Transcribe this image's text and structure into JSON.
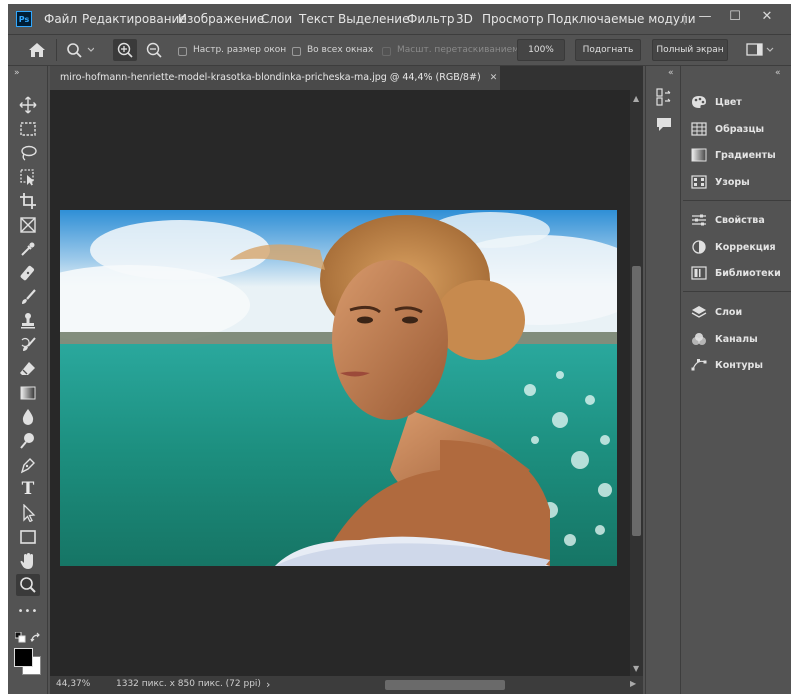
{
  "app": {
    "logo": "Ps"
  },
  "menu": [
    "Файл",
    "Редактирование",
    "Изображение",
    "Слои",
    "Текст",
    "Выделение",
    "Фильтр",
    "3D",
    "Просмотр",
    "Подключаемые модули",
    "("
  ],
  "window_controls": {
    "minimize": "—",
    "maximize": "☐",
    "close": "✕"
  },
  "options": {
    "resize_windows": "Настр. размер окон",
    "all_windows": "Во всех окнах",
    "scrubby_zoom": "Масшт. перетаскиванием",
    "zoom_100": "100%",
    "fit": "Подогнать",
    "fullscreen": "Полный экран"
  },
  "document": {
    "tab_title": "miro-hofmann-henriette-model-krasotka-blondinka-pricheska-ma.jpg @ 44,4% (RGB/8#)",
    "tab_close": "✕",
    "zoom": "44,37%",
    "info": "1332 пикс. x 850 пикс. (72 ppi)",
    "status_arrow": "›"
  },
  "tools": [
    "move-icon",
    "marquee-icon",
    "lasso-icon",
    "object-select-icon",
    "crop-icon",
    "frame-icon",
    "eyedropper-icon",
    "healing-brush-icon",
    "brush-icon",
    "clone-stamp-icon",
    "history-brush-icon",
    "eraser-icon",
    "gradient-icon",
    "blur-icon",
    "dodge-icon",
    "pen-icon",
    "type-icon",
    "path-select-icon",
    "rectangle-icon",
    "hand-icon",
    "zoom-icon",
    "more-tools-icon"
  ],
  "tool_type_label": "T",
  "tool_more_label": "•••",
  "panels": {
    "group1": [
      "Цвет",
      "Образцы",
      "Градиенты",
      "Узоры"
    ],
    "group2": [
      "Свойства",
      "Коррекция",
      "Библиотеки"
    ],
    "group3": [
      "Слои",
      "Каналы",
      "Контуры"
    ]
  },
  "collapse_left": "»",
  "collapse_right": "«",
  "colors": {
    "ui": "#535353",
    "dark": "#282828",
    "foreground": "#000000",
    "background": "#ffffff"
  }
}
